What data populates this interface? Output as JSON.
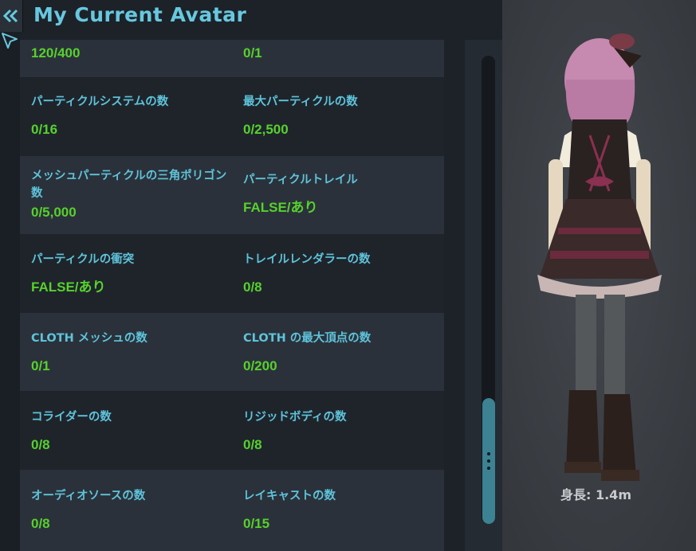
{
  "header": {
    "title": "My Current Avatar"
  },
  "stats": {
    "top_partial": {
      "a_value": "120/400",
      "b_value": "0/1"
    },
    "rows": [
      {
        "a": {
          "label": "パーティクルシステムの数",
          "value": "0/16"
        },
        "b": {
          "label": "最大パーティクルの数",
          "value": "0/2,500"
        }
      },
      {
        "a": {
          "label": "メッシュパーティクルの三角ポリゴン数",
          "value": "0/5,000"
        },
        "b": {
          "label": "パーティクルトレイル",
          "value": "FALSE/あり"
        }
      },
      {
        "a": {
          "label": "パーティクルの衝突",
          "value": "FALSE/あり"
        },
        "b": {
          "label": "トレイルレンダラーの数",
          "value": "0/8"
        }
      },
      {
        "a": {
          "label": "CLOTH メッシュの数",
          "value": "0/1"
        },
        "b": {
          "label": "CLOTH の最大頂点の数",
          "value": "0/200"
        }
      },
      {
        "a": {
          "label": "コライダーの数",
          "value": "0/8"
        },
        "b": {
          "label": "リジッドボディの数",
          "value": "0/8"
        }
      },
      {
        "a": {
          "label": "オーディオソースの数",
          "value": "0/8"
        },
        "b": {
          "label": "レイキャストの数",
          "value": "0/15"
        }
      }
    ]
  },
  "preview": {
    "height_text": "身長: 1.4m"
  },
  "colors": {
    "accent": "#67c8df",
    "label": "#5ec3da",
    "value_ok": "#56d12d",
    "row_shaded": "#2b313a",
    "row_plain": "#1f242b"
  },
  "icons": {
    "back": "double-chevron-left-icon",
    "cursor": "pointer-cursor-icon"
  }
}
